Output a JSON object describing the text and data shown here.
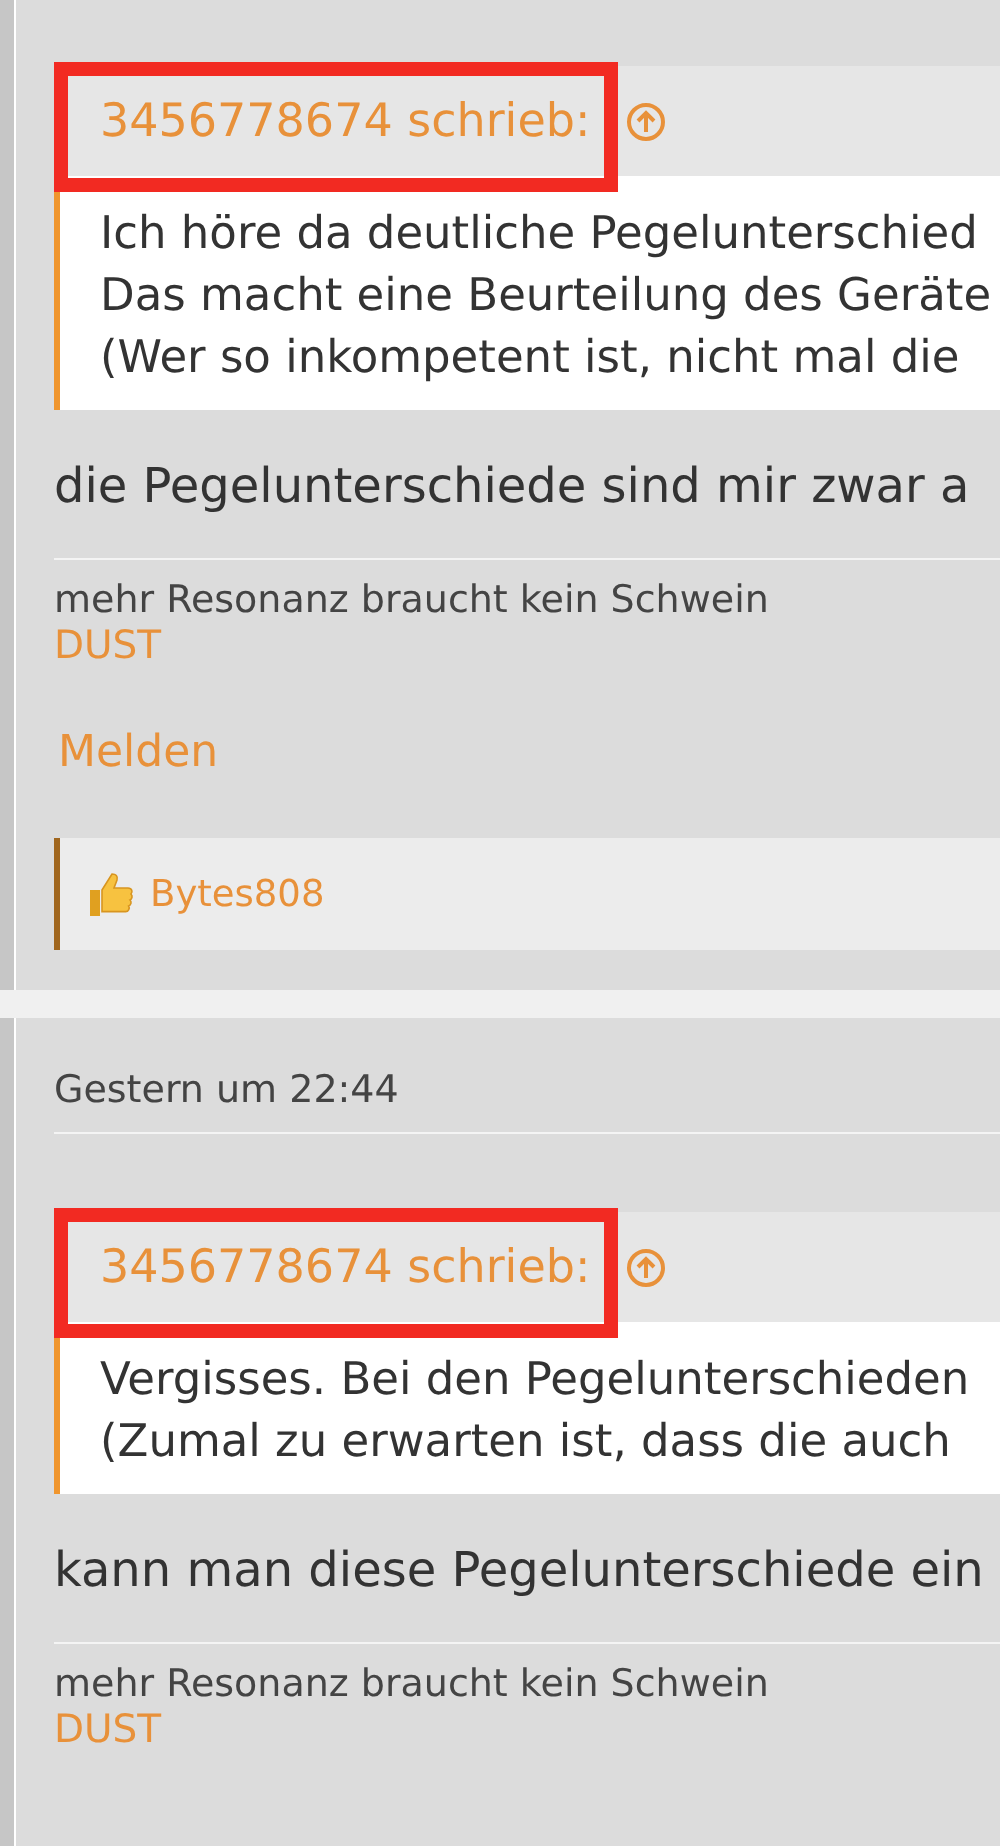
{
  "posts": [
    {
      "quote": {
        "author_line": "3456778674 schrieb:",
        "highlighted": true,
        "lines": [
          "Ich höre da deutliche Pegelunterschied",
          "Das macht eine Beurteilung des Geräte",
          "(Wer so inkompetent ist, nicht mal die"
        ]
      },
      "text": "die Pegelunterschiede sind mir zwar a",
      "signature": "mehr Resonanz braucht kein Schwein",
      "signature_name": "DUST",
      "report_link": "Melden",
      "likes": [
        "Bytes808"
      ]
    },
    {
      "timestamp": "Gestern um 22:44",
      "quote": {
        "author_line": "3456778674 schrieb:",
        "highlighted": true,
        "lines": [
          "Vergisses. Bei den Pegelunterschieden",
          "(Zumal zu erwarten ist, dass die auch"
        ]
      },
      "text": "kann man diese Pegelunterschiede ein",
      "signature": "mehr Resonanz braucht kein Schwein",
      "signature_name": "DUST"
    }
  ]
}
